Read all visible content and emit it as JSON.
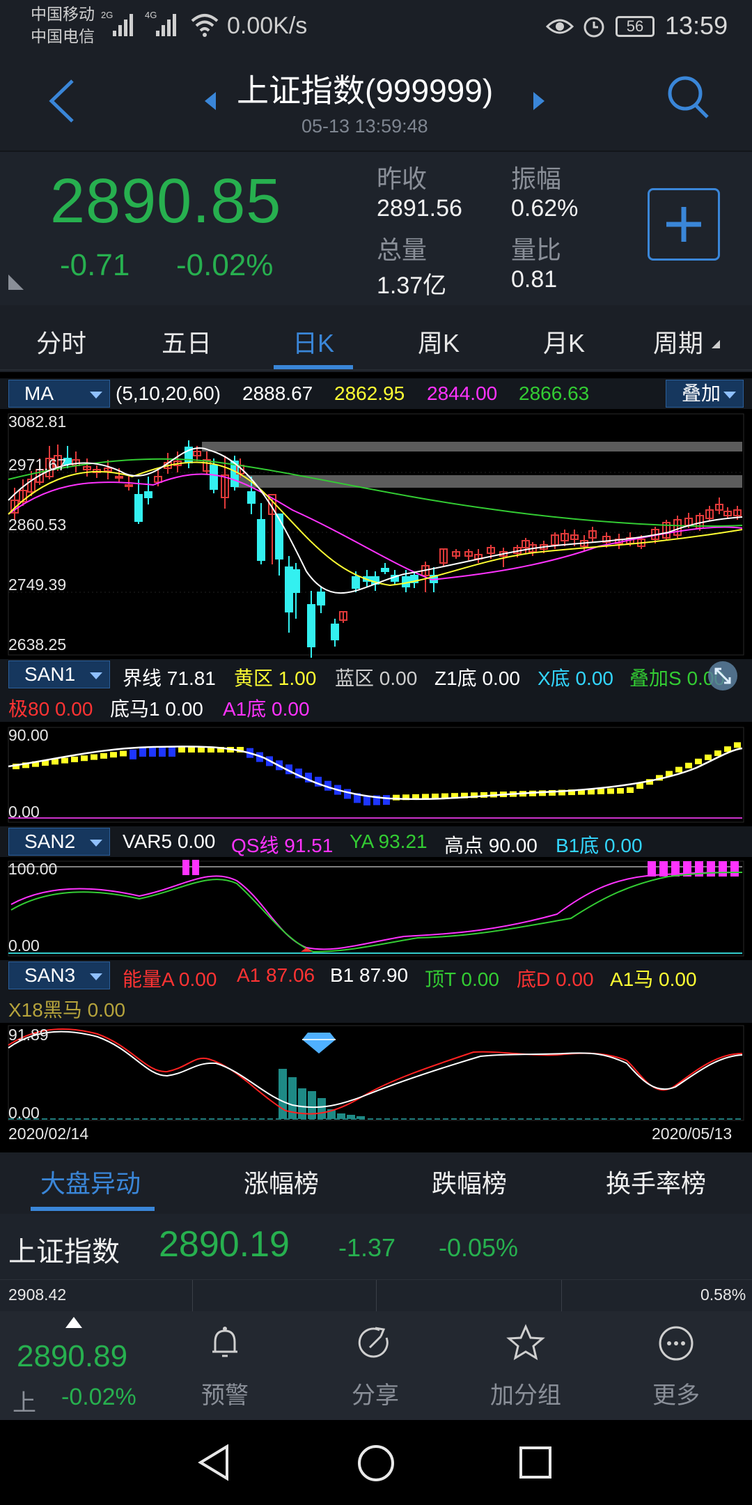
{
  "status": {
    "carrier1": "中国移动",
    "carrier2": "中国电信",
    "net_gen1": "2G",
    "net_gen2": "4G",
    "net_speed": "0.00K/s",
    "battery": "56",
    "time": "13:59"
  },
  "header": {
    "title": "上证指数(999999)",
    "timestamp": "05-13 13:59:48"
  },
  "quote": {
    "price": "2890.85",
    "change": "-0.71",
    "change_pct": "-0.02%",
    "prev_close_label": "昨收",
    "prev_close": "2891.56",
    "amplitude_label": "振幅",
    "amplitude": "0.62%",
    "volume_label": "总量",
    "volume": "1.37亿",
    "volume_ratio_label": "量比",
    "volume_ratio": "0.81",
    "price_color": "#27b04f"
  },
  "tabs": [
    "分时",
    "五日",
    "日K",
    "周K",
    "月K",
    "周期"
  ],
  "active_tab": "日K",
  "ma_bar": {
    "selector": "MA",
    "params": "(5,10,20,60)",
    "ma5": "2888.67",
    "ma10": "2862.95",
    "ma20": "2844.00",
    "ma60": "2866.63",
    "overlay": "叠加"
  },
  "kline_axis": [
    "3082.81",
    "2971.67",
    "2860.53",
    "2749.39",
    "2638.25"
  ],
  "san1": {
    "selector": "SAN1",
    "items": [
      {
        "label": "界线",
        "value": "71.81"
      },
      {
        "label": "黄区",
        "value": "1.00"
      },
      {
        "label": "蓝区",
        "value": "0.00"
      },
      {
        "label": "Z1底",
        "value": "0.00"
      },
      {
        "label": "X底",
        "value": "0.00"
      },
      {
        "label": "叠加S",
        "value": "0.00"
      },
      {
        "label": "极80",
        "value": "0.00"
      },
      {
        "label": "底马1",
        "value": "0.00"
      },
      {
        "label": "A1底",
        "value": "0.00"
      }
    ],
    "axis_top": "90.00",
    "axis_bottom": "0.00"
  },
  "san2": {
    "selector": "SAN2",
    "items": [
      {
        "label": "VAR5",
        "value": "0.00"
      },
      {
        "label": "QS线",
        "value": "91.51"
      },
      {
        "label": "YA",
        "value": "93.21"
      },
      {
        "label": "高点",
        "value": "90.00"
      },
      {
        "label": "B1底",
        "value": "0.00"
      }
    ],
    "axis_top": "100.00",
    "axis_bottom": "0.00"
  },
  "san3": {
    "selector": "SAN3",
    "items": [
      {
        "label": "能量A",
        "value": "0.00"
      },
      {
        "label": "A1",
        "value": "87.06"
      },
      {
        "label": "B1",
        "value": "87.90"
      },
      {
        "label": "顶T",
        "value": "0.00"
      },
      {
        "label": "底D",
        "value": "0.00"
      },
      {
        "label": "A1马",
        "value": "0.00"
      },
      {
        "label": "X18黑马",
        "value": "0.00"
      }
    ],
    "axis_top": "91.89",
    "axis_bottom": "0.00",
    "date_start": "2020/02/14",
    "date_end": "2020/05/13"
  },
  "low_tabs": [
    "大盘异动",
    "涨幅榜",
    "跌幅榜",
    "换手率榜"
  ],
  "index_row": {
    "name": "上证指数",
    "price": "2890.19",
    "change": "-1.37",
    "change_pct": "-0.05%",
    "mini_left": "2908.42",
    "mini_right": "0.58%"
  },
  "bottom": {
    "price": "2890.89",
    "market": "上",
    "change_pct": "-0.02%",
    "tools": [
      {
        "label": "预警",
        "icon": "bell-icon"
      },
      {
        "label": "分享",
        "icon": "share-icon"
      },
      {
        "label": "加分组",
        "icon": "star-icon"
      },
      {
        "label": "更多",
        "icon": "more-icon"
      }
    ]
  },
  "colors": {
    "up": "#e03a3a",
    "down": "#27b04f",
    "accent": "#3a86d8",
    "ma5": "#ffffff",
    "ma10": "#ffff33",
    "ma20": "#ff33ff",
    "ma60": "#33cc33"
  }
}
